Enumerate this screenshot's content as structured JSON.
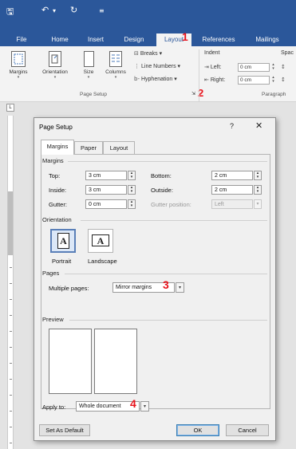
{
  "qat": {
    "save_icon": "save-icon",
    "undo_icon": "undo-icon",
    "redo_icon": "redo-icon",
    "customize_icon": "customize-qat-icon"
  },
  "tabs": [
    {
      "label": "File"
    },
    {
      "label": "Home"
    },
    {
      "label": "Insert"
    },
    {
      "label": "Design"
    },
    {
      "label": "Layout",
      "active": true
    },
    {
      "label": "References"
    },
    {
      "label": "Mailings"
    }
  ],
  "markers": {
    "m1": "1",
    "m2": "2",
    "m3": "3",
    "m4": "4",
    "color": "#e8121b"
  },
  "ribbon": {
    "page_setup": {
      "margins": "Margins",
      "orientation": "Orientation",
      "size": "Size",
      "columns": "Columns",
      "breaks": "Breaks",
      "line_numbers": "Line Numbers",
      "hyphenation": "Hyphenation",
      "group_label": "Page Setup"
    },
    "indent": {
      "heading": "Indent",
      "left_label": "Left:",
      "left_value": "0 cm",
      "right_label": "Right:",
      "right_value": "0 cm"
    },
    "spacing": {
      "heading": "Spac"
    },
    "paragraph_group_label": "Paragraph"
  },
  "ruler_corner": "L",
  "dialog": {
    "title": "Page Setup",
    "help": "?",
    "close": "✕",
    "tabs": [
      "Margins",
      "Paper",
      "Layout"
    ],
    "margins": {
      "heading": "Margins",
      "top_label": "Top:",
      "top_value": "3 cm",
      "bottom_label": "Bottom:",
      "bottom_value": "2 cm",
      "inside_label": "Inside:",
      "inside_value": "3 cm",
      "outside_label": "Outside:",
      "outside_value": "2 cm",
      "gutter_label": "Gutter:",
      "gutter_value": "0 cm",
      "gutter_position_label": "Gutter position:",
      "gutter_position_value": "Left"
    },
    "orientation": {
      "heading": "Orientation",
      "portrait": "Portrait",
      "landscape": "Landscape",
      "glyph": "A"
    },
    "pages": {
      "heading": "Pages",
      "multiple_label": "Multiple pages:",
      "multiple_value": "Mirror margins"
    },
    "preview": {
      "heading": "Preview"
    },
    "apply_to": {
      "label": "Apply to:",
      "value": "Whole document"
    },
    "buttons": {
      "default": "Set As Default",
      "ok": "OK",
      "cancel": "Cancel"
    }
  },
  "colors": {
    "title_bar": "#2b579a",
    "ribbon": "#f3f3f3",
    "dialog_bg": "#f0f0f0",
    "selection": "#dbe7f7"
  }
}
